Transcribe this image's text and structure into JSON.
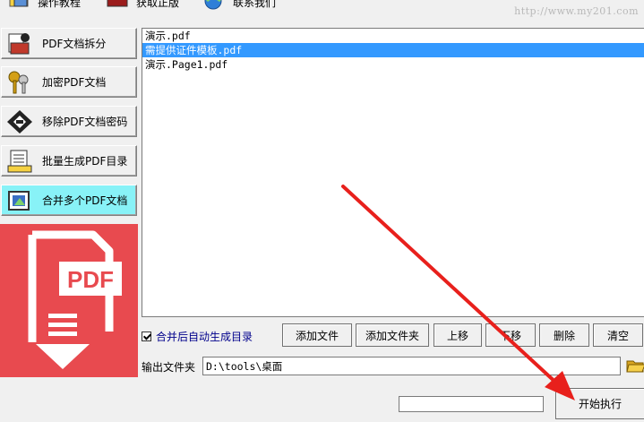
{
  "toolbar": {
    "items": [
      {
        "label": "操作教程",
        "icon": "tutorial-icon"
      },
      {
        "label": "获取正版",
        "icon": "purchase-icon"
      },
      {
        "label": "联系我们",
        "icon": "contact-icon"
      }
    ],
    "watermark_url": "http://www.my201.com"
  },
  "sidebar": {
    "items": [
      {
        "label": "PDF文档拆分",
        "icon": "split-pdf-icon",
        "active": false
      },
      {
        "label": "加密PDF文档",
        "icon": "keys-icon",
        "active": false
      },
      {
        "label": "移除PDF文档密码",
        "icon": "remove-password-icon",
        "active": false
      },
      {
        "label": "批量生成PDF目录",
        "icon": "toc-icon",
        "active": false
      },
      {
        "label": "合并多个PDF文档",
        "icon": "merge-pdf-icon",
        "active": true
      }
    ],
    "banner_text": "PDF"
  },
  "file_list": {
    "items": [
      {
        "name": "演示.pdf",
        "selected": false
      },
      {
        "name": "需提供证件模板.pdf",
        "selected": true
      },
      {
        "name": "演示.Page1.pdf",
        "selected": false
      }
    ]
  },
  "options": {
    "auto_toc_label": "合并后自动生成目录",
    "auto_toc_checked": true
  },
  "actions": {
    "add_file": "添加文件",
    "add_folder": "添加文件夹",
    "move_up": "上移",
    "move_down": "下移",
    "delete": "删除",
    "clear": "清空"
  },
  "output": {
    "label": "输出文件夹",
    "path": "D:\\tools\\桌面"
  },
  "progress": {
    "fraction": 0
  },
  "start_button": "开始执行",
  "colors": {
    "active_tab": "#88f2f7",
    "selection": "#3399ff",
    "banner": "#e84a4f",
    "annotation_arrow": "#e8201c"
  }
}
